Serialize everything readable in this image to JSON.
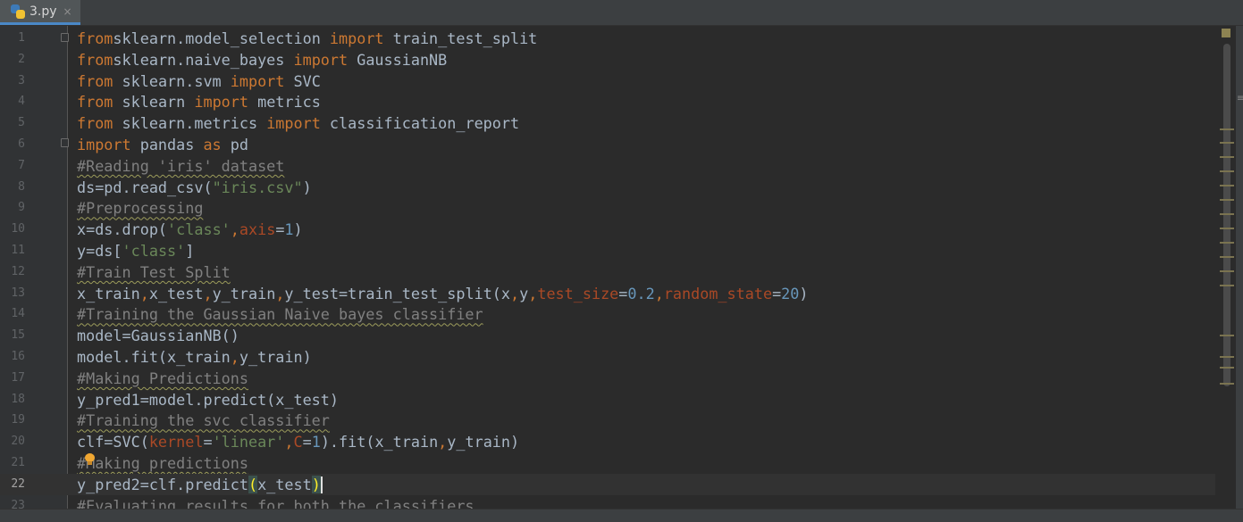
{
  "tab": {
    "filename": "3.py",
    "close_glyph": "×",
    "icon": "python-file-icon"
  },
  "editor": {
    "current_line": 22,
    "lines": [
      {
        "n": "1"
      },
      {
        "n": "2"
      },
      {
        "n": "3"
      },
      {
        "n": "4"
      },
      {
        "n": "5"
      },
      {
        "n": "6"
      },
      {
        "n": "7"
      },
      {
        "n": "8"
      },
      {
        "n": "9"
      },
      {
        "n": "10"
      },
      {
        "n": "11"
      },
      {
        "n": "12"
      },
      {
        "n": "13"
      },
      {
        "n": "14"
      },
      {
        "n": "15"
      },
      {
        "n": "16"
      },
      {
        "n": "17"
      },
      {
        "n": "18"
      },
      {
        "n": "19"
      },
      {
        "n": "20"
      },
      {
        "n": "21"
      },
      {
        "n": "22"
      },
      {
        "n": "23"
      }
    ],
    "code": [
      [
        [
          "kw",
          "from"
        ],
        [
          "",
          "sklearn.model_selection "
        ],
        [
          "kw",
          "import"
        ],
        [
          "",
          " train_test_split"
        ]
      ],
      [
        [
          "kw",
          "from"
        ],
        [
          "",
          "sklearn.naive_bayes "
        ],
        [
          "kw",
          "import"
        ],
        [
          "",
          " GaussianNB"
        ]
      ],
      [
        [
          "kw",
          "from"
        ],
        [
          "",
          " sklearn.svm "
        ],
        [
          "kw",
          "import"
        ],
        [
          "",
          " SVC"
        ]
      ],
      [
        [
          "kw",
          "from"
        ],
        [
          "",
          " sklearn "
        ],
        [
          "kw",
          "import"
        ],
        [
          "",
          " metrics"
        ]
      ],
      [
        [
          "kw",
          "from"
        ],
        [
          "",
          " sklearn.metrics "
        ],
        [
          "kw",
          "import"
        ],
        [
          "",
          " classification_report"
        ]
      ],
      [
        [
          "kw",
          "import"
        ],
        [
          "",
          " pandas "
        ],
        [
          "kw",
          "as"
        ],
        [
          "",
          " pd"
        ]
      ],
      [
        [
          "cm",
          "#Reading 'iris' dataset"
        ]
      ],
      [
        [
          "",
          "ds=pd.read_csv("
        ],
        [
          "str",
          "\"iris.csv\""
        ],
        [
          "",
          ")"
        ]
      ],
      [
        [
          "cm",
          "#Preprocessing"
        ]
      ],
      [
        [
          "",
          "x=ds.drop("
        ],
        [
          "str",
          "'class'"
        ],
        [
          "kw",
          ","
        ],
        [
          "param",
          "axis"
        ],
        [
          "",
          "="
        ],
        [
          "num",
          "1"
        ],
        [
          "",
          ")"
        ]
      ],
      [
        [
          "",
          "y=ds["
        ],
        [
          "str",
          "'class'"
        ],
        [
          "",
          "]"
        ]
      ],
      [
        [
          "cm",
          "#Train Test Split"
        ]
      ],
      [
        [
          "",
          "x_train"
        ],
        [
          "kw",
          ","
        ],
        [
          "",
          "x_test"
        ],
        [
          "kw",
          ","
        ],
        [
          "",
          "y_train"
        ],
        [
          "kw",
          ","
        ],
        [
          "",
          "y_test=train_test_split(x"
        ],
        [
          "kw",
          ","
        ],
        [
          "",
          "y"
        ],
        [
          "kw",
          ","
        ],
        [
          "param",
          "test_size"
        ],
        [
          "",
          "="
        ],
        [
          "num",
          "0.2"
        ],
        [
          "kw",
          ","
        ],
        [
          "param",
          "random_state"
        ],
        [
          "",
          "="
        ],
        [
          "num",
          "20"
        ],
        [
          "",
          ")"
        ]
      ],
      [
        [
          "cm",
          "#Training the Gaussian Naive bayes classifier"
        ]
      ],
      [
        [
          "",
          "model=GaussianNB()"
        ]
      ],
      [
        [
          "",
          "model.fit(x_train"
        ],
        [
          "kw",
          ","
        ],
        [
          "",
          "y_train)"
        ]
      ],
      [
        [
          "cm",
          "#Making Predictions"
        ]
      ],
      [
        [
          "",
          "y_pred1=model.predict(x_test)"
        ]
      ],
      [
        [
          "cm",
          "#Training the svc classifier"
        ]
      ],
      [
        [
          "",
          "clf=SVC("
        ],
        [
          "param",
          "kernel"
        ],
        [
          "",
          "="
        ],
        [
          "str",
          "'linear'"
        ],
        [
          "kw",
          ","
        ],
        [
          "param",
          "C"
        ],
        [
          "",
          "="
        ],
        [
          "num",
          "1"
        ],
        [
          "",
          ").fit(x_train"
        ],
        [
          "kw",
          ","
        ],
        [
          "",
          "y_train)"
        ]
      ],
      [
        [
          "cm",
          "#Making predictions"
        ]
      ],
      [
        [
          "",
          "y_pred2=clf.predict"
        ],
        [
          "brace",
          "("
        ],
        [
          "",
          "x_test"
        ],
        [
          "brace",
          ")"
        ],
        [
          "caret",
          ""
        ]
      ],
      [
        [
          "cm",
          "#Evaluating results for both the classifiers."
        ]
      ]
    ]
  },
  "marks_count": 16
}
